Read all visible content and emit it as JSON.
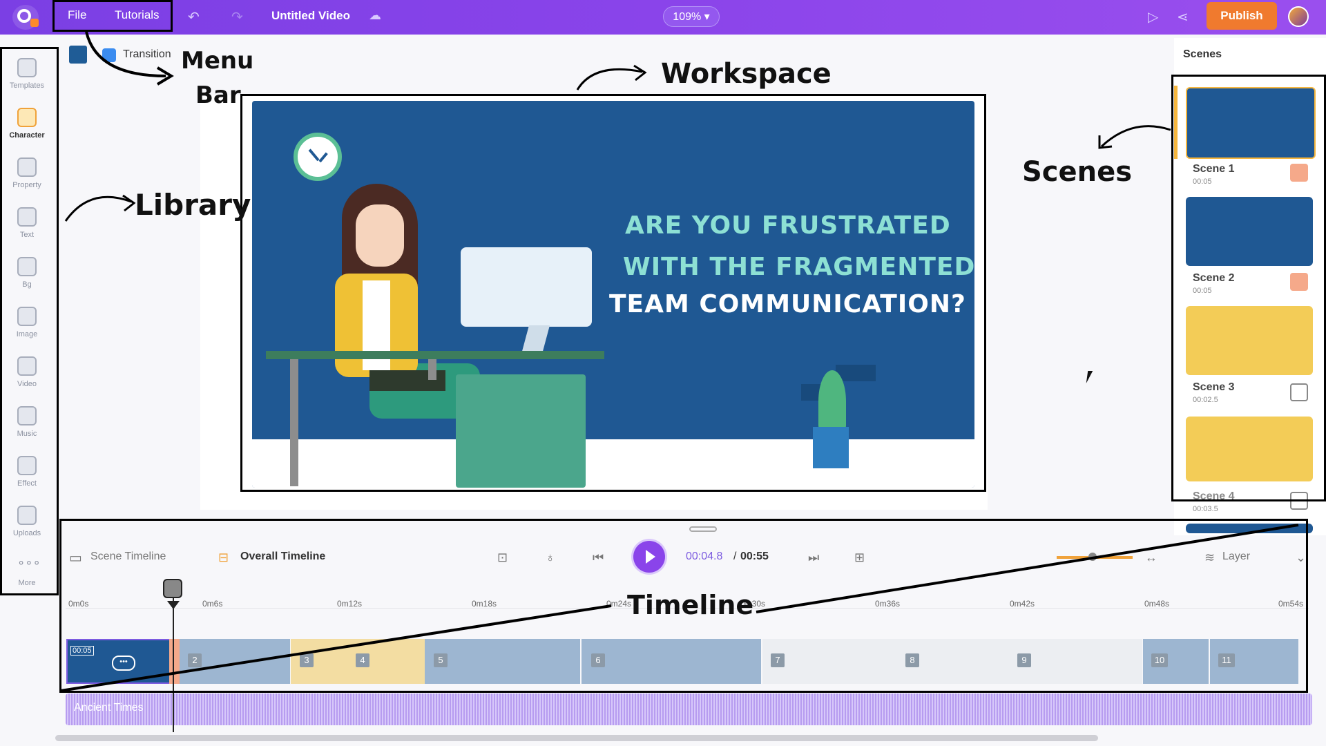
{
  "topbar": {
    "menu": {
      "file": "File",
      "tutorials": "Tutorials"
    },
    "title": "Untitled Video",
    "zoom": "109%",
    "publish": "Publish"
  },
  "library": {
    "items": [
      {
        "label": "Templates",
        "icon": "templates-icon"
      },
      {
        "label": "Character",
        "icon": "character-icon",
        "active": true
      },
      {
        "label": "Property",
        "icon": "property-icon"
      },
      {
        "label": "Text",
        "icon": "text-icon"
      },
      {
        "label": "Bg",
        "icon": "background-icon"
      },
      {
        "label": "Image",
        "icon": "image-icon"
      },
      {
        "label": "Video",
        "icon": "video-icon"
      },
      {
        "label": "Music",
        "icon": "music-icon"
      },
      {
        "label": "Effect",
        "icon": "effect-icon"
      },
      {
        "label": "Uploads",
        "icon": "uploads-icon"
      },
      {
        "label": "More",
        "icon": "more-icon"
      }
    ]
  },
  "scene_toolbar": {
    "transition": "Transition"
  },
  "canvas": {
    "headline": [
      "ARE YOU FRUSTRATED",
      "WITH THE FRAGMENTED",
      "TEAM COMMUNICATION?"
    ]
  },
  "scenes_panel": {
    "title": "Scenes",
    "scenes": [
      {
        "name": "Scene 1",
        "duration": "00:05",
        "color": "#1f5893"
      },
      {
        "name": "Scene 2",
        "duration": "00:05",
        "color": "#1f5893"
      },
      {
        "name": "Scene 3",
        "duration": "00:02.5",
        "color": "#f3cc57"
      },
      {
        "name": "Scene 4",
        "duration": "00:03.5",
        "color": "#f3cc57"
      }
    ]
  },
  "annotations": {
    "menu_bar": [
      "Menu",
      "Bar"
    ],
    "workspace": "Workspace",
    "library": "Library",
    "scenes": "Scenes",
    "timeline": "Timeline"
  },
  "timeline": {
    "scene_timeline": "Scene Timeline",
    "overall_timeline": "Overall Timeline",
    "current_time": "00:04.8",
    "separator": "/",
    "total_time": "00:55",
    "layer": "Layer",
    "first_clip_duration": "00:05",
    "ruler": [
      "0m0s",
      "0m6s",
      "0m12s",
      "0m18s",
      "0m24s",
      "0m30s",
      "0m36s",
      "0m42s",
      "0m48s",
      "0m54s"
    ],
    "segments": [
      "2",
      "3",
      "4",
      "5",
      "6",
      "7",
      "8",
      "9",
      "10",
      "11"
    ],
    "audio_track": "Ancient Times"
  },
  "colors": {
    "accent": "#8a44ea",
    "publish": "#f07a2e",
    "scene_blue": "#1f5893",
    "scene_yellow": "#f3cc57"
  }
}
